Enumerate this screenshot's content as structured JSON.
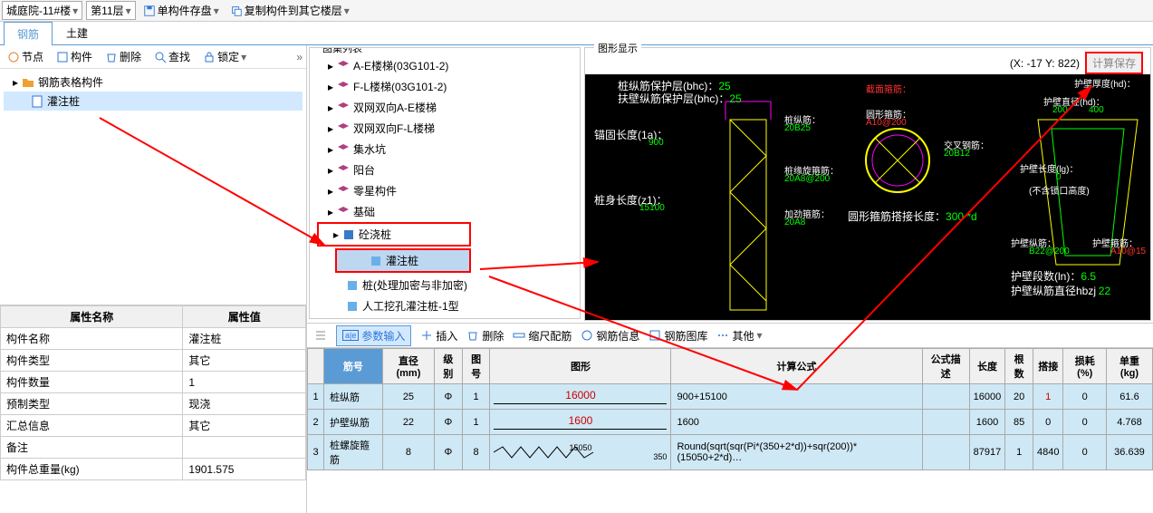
{
  "toolbar": {
    "building": "城庭院-11#楼",
    "floor": "第11层",
    "save_single": "单构件存盘",
    "copy_to": "复制构件到其它楼层"
  },
  "tabs": {
    "rebar": "钢筋",
    "civil": "土建"
  },
  "left_toolbar": {
    "node": "节点",
    "component": "构件",
    "delete": "删除",
    "search": "查找",
    "lock": "锁定"
  },
  "tree": {
    "root": "钢筋表格构件",
    "child": "灌注桩"
  },
  "props": {
    "h_name": "属性名称",
    "h_val": "属性值",
    "rows": [
      {
        "n": "构件名称",
        "v": "灌注桩"
      },
      {
        "n": "构件类型",
        "v": "其它"
      },
      {
        "n": "构件数量",
        "v": "1"
      },
      {
        "n": "预制类型",
        "v": "现浇"
      },
      {
        "n": "汇总信息",
        "v": "其它"
      },
      {
        "n": "备注",
        "v": ""
      },
      {
        "n": "构件总重量(kg)",
        "v": "1901.575"
      }
    ]
  },
  "atlas": {
    "title": "图集列表",
    "items": [
      "A-E楼梯(03G101-2)",
      "F-L楼梯(03G101-2)",
      "双网双向A-E楼梯",
      "双网双向F-L楼梯",
      "集水坑",
      "阳台",
      "零星构件",
      "基础"
    ],
    "parent": "砼浇桩",
    "subs": [
      "灌注桩",
      "桩(处理加密与非加密)",
      "人工挖孔灌注桩-1型"
    ]
  },
  "graphic": {
    "title": "图形显示",
    "coord": "(X: -17 Y: 822)",
    "calc_save": "计算保存",
    "labels": {
      "l1": "桩纵筋保护层(bhc)：",
      "l1v": "25",
      "l2": "扶壁纵筋保护层(bhc)：",
      "l2v": "25",
      "l3": "锚固长度(1a)：",
      "l3v": "900",
      "l4": "桩身长度(z1)：",
      "l4v": "15100",
      "l5": "桩纵筋：",
      "l5v": "20B25",
      "l6": "桩缘旋箍筋：",
      "l6v": "20A8@200",
      "l7": "加劲箍筋：",
      "l7v": "20A8",
      "l8": "截面箍筋：",
      "l9": "圆形箍筋：",
      "l9v": "A10@200",
      "l10": "交叉钢筋：",
      "l10v": "20B12",
      "l11": "圆形箍筋搭接长度：",
      "l11v": "300 *d",
      "l12": "护壁厚度(hd)：",
      "l13": "护壁直径(hd)：",
      "l13a": "200",
      "l13b": "400",
      "l14": "护壁长度(lg)：",
      "l14v": "0",
      "l14b": "(不含锁口高度)",
      "l15": "护壁纵筋：",
      "l15v": "B22@200",
      "l16": "护壁箍筋：",
      "l16v": "A10@15",
      "l17": "护壁段数(ln)：",
      "l17v": "6.5",
      "l18": "护壁纵筋直径hbzj",
      "l18v": "22"
    }
  },
  "bottom_tb": {
    "param": "参数输入",
    "insert": "插入",
    "delete": "删除",
    "scale": "缩尺配筋",
    "info": "钢筋信息",
    "lib": "钢筋图库",
    "other": "其他"
  },
  "grid": {
    "headers": [
      "筋号",
      "直径(mm)",
      "级别",
      "图号",
      "图形",
      "计算公式",
      "公式描述",
      "长度",
      "根数",
      "搭接",
      "损耗(%)",
      "单重(kg)"
    ],
    "rows": [
      {
        "no": "1",
        "name": "桩纵筋",
        "dia": "25",
        "lvl": "Φ",
        "fig": "1",
        "shape": "16000",
        "formula": "900+15100",
        "desc": "",
        "len": "16000",
        "cnt": "20",
        "lap": "1",
        "loss": "0",
        "wt": "61.6"
      },
      {
        "no": "2",
        "name": "护壁纵筋",
        "dia": "22",
        "lvl": "Φ",
        "fig": "1",
        "shape": "1600",
        "formula": "1600",
        "desc": "",
        "len": "1600",
        "cnt": "85",
        "lap": "0",
        "loss": "0",
        "wt": "4.768"
      },
      {
        "no": "3",
        "name": "桩螺旋箍筋",
        "dia": "8",
        "lvl": "Φ",
        "fig": "8",
        "shape": "15050/350",
        "formula": "Round(sqrt(sqr(Pi*(350+2*d))+sqr(200))*(15050+2*d)…",
        "desc": "",
        "len": "87917",
        "cnt": "1",
        "lap": "4840",
        "loss": "0",
        "wt": "36.639"
      }
    ]
  }
}
